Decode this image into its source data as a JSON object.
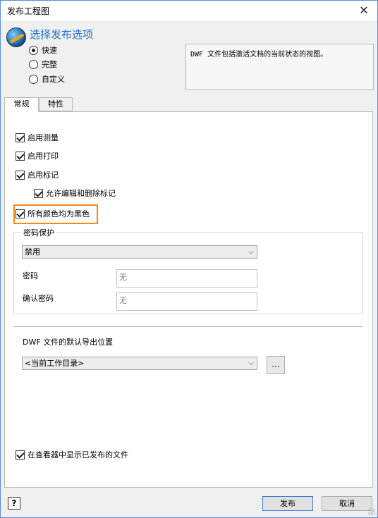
{
  "window": {
    "title": "发布工程图"
  },
  "header": {
    "title": "选择发布选项"
  },
  "options": [
    {
      "label": "快速",
      "checked": true
    },
    {
      "label": "完整",
      "checked": false
    },
    {
      "label": "自定义",
      "checked": false
    }
  ],
  "description": "DWF 文件包括激活文档的当前状态的视图。",
  "tabs": [
    {
      "label": "常规",
      "active": true
    },
    {
      "label": "特性",
      "active": false
    }
  ],
  "general": {
    "enable_measure": "启用测量",
    "enable_print": "启用打印",
    "enable_markup": "启用标记",
    "allow_edit_delete_markup": "允许编辑和删除标记",
    "all_colors_black": "所有颜色均为黑色",
    "password": {
      "legend": "密码保护",
      "mode_selected": "禁用",
      "password_label": "密码",
      "password_placeholder": "无",
      "confirm_label": "确认密码",
      "confirm_placeholder": "无"
    },
    "export_location": {
      "label": "DWF 文件的默认导出位置",
      "selected": "<当前工作目录>",
      "browse_label": "..."
    },
    "show_in_viewer": "在查看器中显示已发布的文件"
  },
  "footer": {
    "help_label": "?",
    "publish_label": "发布",
    "cancel_label": "取消"
  },
  "colors": {
    "accent": "#1f6fc2",
    "highlight": "#f08a1a"
  }
}
